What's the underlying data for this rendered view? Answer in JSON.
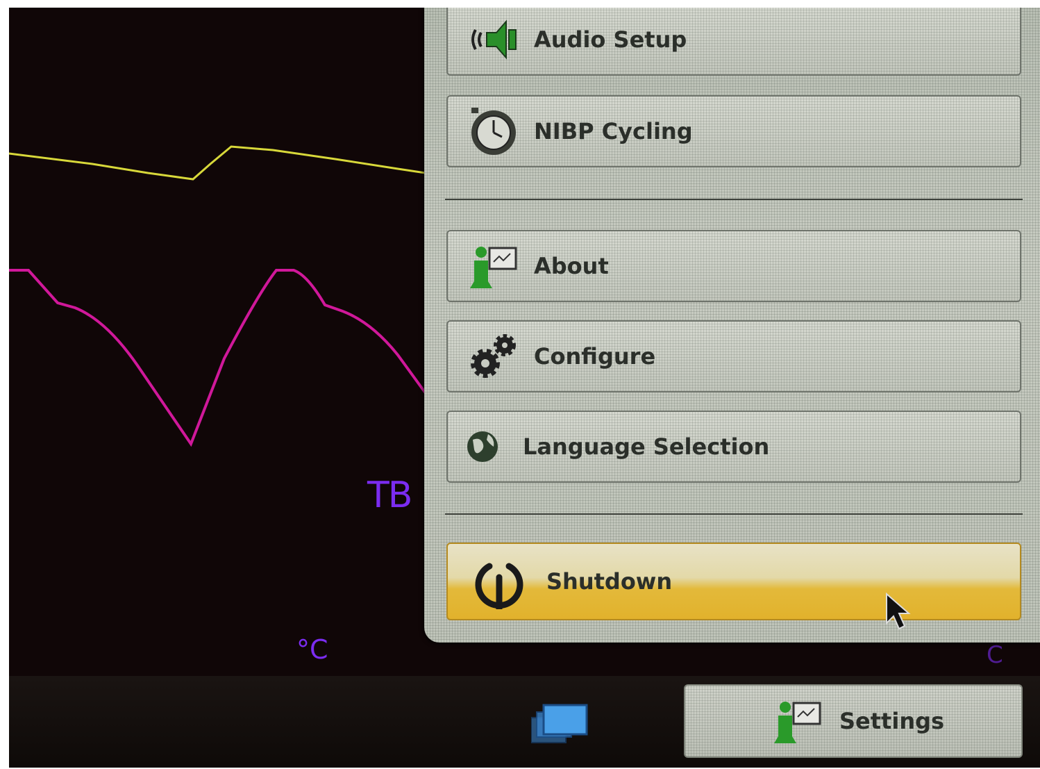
{
  "waveforms": {
    "label": "TB",
    "unit": "°C",
    "unit_secondary": "C",
    "colors": {
      "yellow": "#d8d83a",
      "magenta": "#d0189a",
      "label": "#7b2cf0"
    }
  },
  "menu": {
    "items": [
      {
        "label": "Audio Setup",
        "icon": "speaker-icon"
      },
      {
        "label": "NIBP Cycling",
        "icon": "stopwatch-icon"
      },
      {
        "label": "About",
        "icon": "person-monitor-icon"
      },
      {
        "label": "Configure",
        "icon": "gears-icon"
      },
      {
        "label": "Language Selection",
        "icon": "globe-icon"
      }
    ],
    "shutdown": {
      "label": "Shutdown",
      "icon": "power-icon",
      "accent": "#e2b22c"
    }
  },
  "taskbar": {
    "windows_icon": "windows-switch-icon",
    "settings": {
      "label": "Settings",
      "icon": "person-monitor-icon"
    }
  }
}
